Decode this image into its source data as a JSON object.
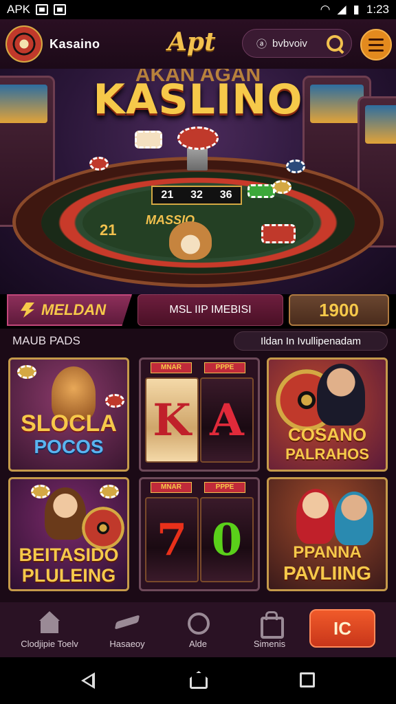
{
  "status_bar": {
    "left_text": "APK",
    "time": "1:23"
  },
  "header": {
    "app_name": "Kasaino",
    "brand": "Apt",
    "search": {
      "value": "bvbvoiv"
    },
    "menu_icon": "hamburger-menu-icon"
  },
  "hero": {
    "top_text": "AKAN AGAN",
    "title": "KASLINO",
    "table_sign": [
      "21",
      "32",
      "36"
    ],
    "table_label": "MASSIO",
    "table_number": "21"
  },
  "actions": {
    "primary_label": "MELDAN",
    "secondary_label": "MSL IIP IMEBISI",
    "counter": "1900"
  },
  "section": {
    "title": "MAUB PADS",
    "tag": "Ildan In Ivullipenadam"
  },
  "games": [
    {
      "title_line1": "SLOCLA",
      "title_line2": "POCOS"
    },
    {
      "reel_caps": [
        "MNAR",
        "PPPE"
      ],
      "reel_symbols": [
        "K",
        "A"
      ]
    },
    {
      "title_line1": "COSANO",
      "title_line2": "PALRAHOS"
    },
    {
      "title_line1": "BEITASIDO",
      "title_line2": "PLULEING"
    },
    {
      "reel_caps": [
        "MNAR",
        "PPPE"
      ],
      "reel_symbols": [
        "7",
        "0"
      ]
    },
    {
      "title_line1": "PPANNA",
      "title_line2": "PAVLIING"
    }
  ],
  "bottom_nav": {
    "items": [
      {
        "label": "Clodjipie Toelv",
        "icon": "home-icon"
      },
      {
        "label": "Hasaeoy",
        "icon": "plane-icon"
      },
      {
        "label": "Alde",
        "icon": "clock-icon"
      },
      {
        "label": "Simenis",
        "icon": "bag-icon"
      }
    ],
    "cta_label": "IC"
  },
  "colors": {
    "gold": "#f6c94a",
    "background": "#1b0a16",
    "cta": "#e8481f"
  }
}
